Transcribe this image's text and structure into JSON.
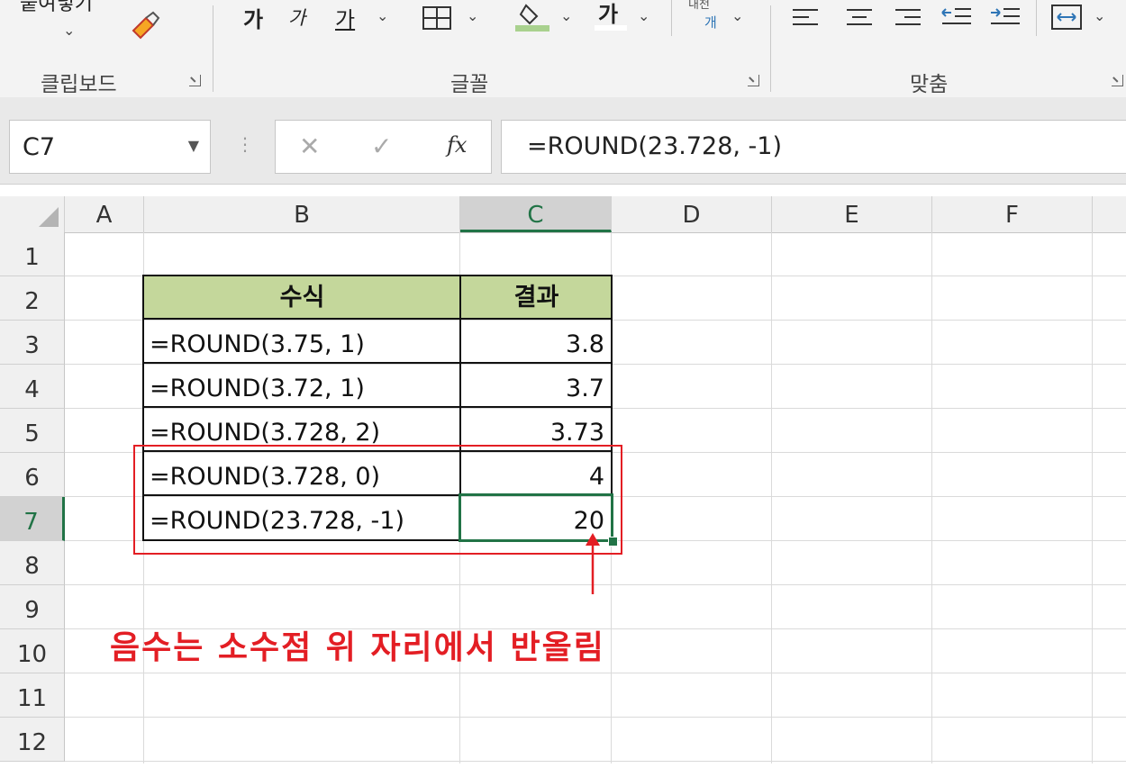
{
  "ribbon": {
    "paste_label": "붙여넣기",
    "clipboard_group": "클립보드",
    "font_group": "글꼴",
    "align_group": "맞춤",
    "font_increase": "가",
    "font_decrease": "가",
    "underline": "가",
    "font_color_letter": "가",
    "phonetic_label": "내천",
    "phonetic_sub": "개",
    "icons": [
      "format-painter-icon",
      "borders-icon",
      "fill-color-icon",
      "font-color-icon",
      "align-left-icon",
      "align-center-icon",
      "align-right-icon",
      "decrease-indent-icon",
      "increase-indent-icon",
      "merge-icon"
    ]
  },
  "formula_bar": {
    "name_box": "C7",
    "cancel_glyph": "✕",
    "enter_glyph": "✓",
    "fx_label": "fx",
    "formula": "=ROUND(23.728, -1)"
  },
  "sheet": {
    "columns": [
      "A",
      "B",
      "C",
      "D",
      "E",
      "F"
    ],
    "rows": [
      "1",
      "2",
      "3",
      "4",
      "5",
      "6",
      "7",
      "8",
      "9",
      "10",
      "11",
      "12"
    ],
    "selected_column": "C",
    "selected_row": "7"
  },
  "table": {
    "headers": [
      "수식",
      "결과"
    ],
    "rows": [
      {
        "formula": "=ROUND(3.75, 1)",
        "result": "3.8"
      },
      {
        "formula": "=ROUND(3.72, 1)",
        "result": "3.7"
      },
      {
        "formula": "=ROUND(3.728, 2)",
        "result": "3.73"
      },
      {
        "formula": "=ROUND(3.728, 0)",
        "result": "4"
      },
      {
        "formula": "=ROUND(23.728, -1)",
        "result": "20"
      }
    ]
  },
  "annotation": "음수는 소수점 위 자리에서 반올림",
  "colors": {
    "header_fill": "#c4d79b",
    "accent_green": "#217346",
    "annotation_red": "#e31e24"
  }
}
